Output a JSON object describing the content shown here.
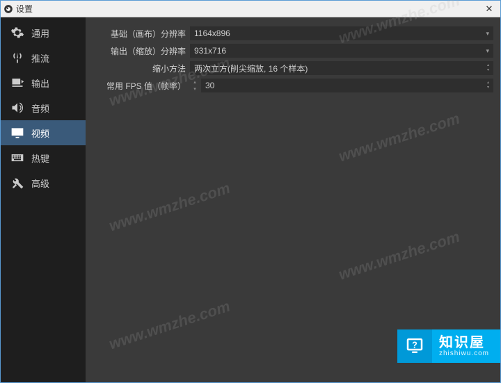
{
  "window": {
    "title": "设置"
  },
  "sidebar": {
    "items": [
      {
        "label": "通用"
      },
      {
        "label": "推流"
      },
      {
        "label": "输出"
      },
      {
        "label": "音频"
      },
      {
        "label": "视频"
      },
      {
        "label": "热键"
      },
      {
        "label": "高级"
      }
    ]
  },
  "form": {
    "base_res": {
      "label": "基础（画布）分辨率",
      "value": "1164x896"
    },
    "out_res": {
      "label": "输出（缩放）分辨率",
      "value": "931x716"
    },
    "downscale": {
      "label": "缩小方法",
      "value": "两次立方(削尖缩放, 16 个样本)"
    },
    "fps": {
      "label": "常用 FPS 值（帧率）",
      "value": "30"
    }
  },
  "watermarks": [
    "www.wmzhe.com"
  ],
  "brand": {
    "name": "知识屋",
    "domain": "zhishiwu.com"
  }
}
